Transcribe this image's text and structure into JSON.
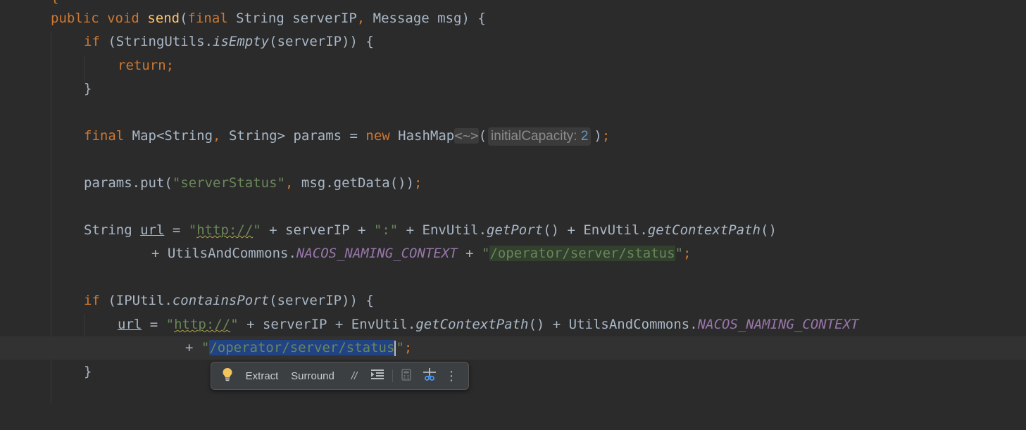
{
  "editor": {
    "top_brace": "{",
    "l1": {
      "kw1": "public",
      "kw2": "void",
      "fn": "send",
      "p1": "(",
      "kw3": "final",
      "rest": " String serverIP",
      "comma": ",",
      "rest2": " Message msg) {"
    },
    "l2": {
      "kw": "if",
      "a": " (StringUtils.",
      "method": "isEmpty",
      "b": "(serverIP)) {"
    },
    "l3": {
      "kw": "return",
      "semi": ";"
    },
    "l4": {
      "text": "}"
    },
    "l5": {
      "kw1": "final",
      "a": " Map<String",
      "comma": ",",
      "b": " String> params = ",
      "kw2": "new",
      "c": " HashMap",
      "diamond": "<~>",
      "open": "(",
      "hint_label": "initialCapacity:",
      "hint_value": "2",
      "close": ")",
      "semi": ";"
    },
    "l6": {
      "a": "params.put(",
      "str": "\"serverStatus\"",
      "comma": ",",
      "b": " msg.getData())",
      "semi": ";"
    },
    "l7": {
      "a": "String ",
      "var": "url",
      "b": " = ",
      "str_q1": "\"",
      "str_http": "http://",
      "str_q2": "\"",
      "c": " + serverIP + ",
      "str2": "\":\"",
      "d": " + EnvUtil.",
      "m1": "getPort",
      "e": "() + EnvUtil.",
      "m2": "getContextPath",
      "f": "()"
    },
    "l8": {
      "a": "+ UtilsAndCommons.",
      "const": "NACOS_NAMING_CONTEXT",
      "b": " + ",
      "q1": "\"",
      "path": "/operator/server/status",
      "q2": "\"",
      "semi": ";"
    },
    "l9": {
      "kw": "if",
      "a": " (IPUtil.",
      "method": "containsPort",
      "b": "(serverIP)) {"
    },
    "l10": {
      "var": "url",
      "a": " = ",
      "q1": "\"",
      "http": "http://",
      "q2": "\"",
      "b": " + serverIP + EnvUtil.",
      "m": "getContextPath",
      "c": "() + UtilsAndCommons.",
      "const": "NACOS_NAMING_CONTEXT"
    },
    "l11": {
      "a": "+ ",
      "q1": "\"",
      "path": "/operator/server/status",
      "q2": "\"",
      "semi": ";"
    },
    "l12": {
      "text": "}"
    }
  },
  "popup": {
    "items": {
      "bulb_icon": "lightbulb-icon",
      "extract": "Extract",
      "surround": "Surround",
      "comment_icon": "//",
      "reformat_icon": "reformat-icon",
      "calculator_icon": "calculator-icon",
      "cut_icon": "cut-icon",
      "more_icon": "⋮"
    }
  },
  "colors": {
    "background": "#2b2b2b",
    "keyword": "#cc7832",
    "string": "#6a8759",
    "method_decl": "#ffc66d",
    "constant": "#9876aa",
    "number": "#6897bb",
    "selection": "#214283"
  }
}
